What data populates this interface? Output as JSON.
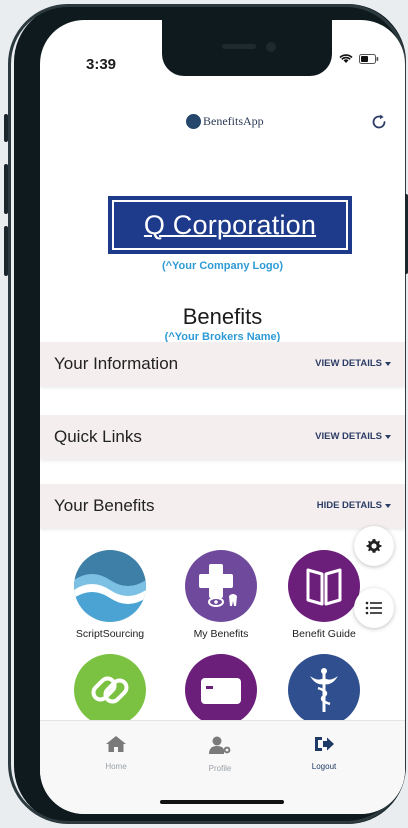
{
  "status": {
    "time": "3:39"
  },
  "appbar": {
    "brand": "BenefitsApp",
    "refresh_icon": "refresh-icon"
  },
  "company": {
    "name": "Q Corporation",
    "note": "(^Your Company Logo)"
  },
  "benefits": {
    "title": "Benefits",
    "broker_note": "(^Your Brokers Name)"
  },
  "sections": [
    {
      "title": "Your Information",
      "action": "VIEW DETAILS"
    },
    {
      "title": "Quick Links",
      "action": "VIEW DETAILS"
    },
    {
      "title": "Your Benefits",
      "action": "HIDE DETAILS"
    }
  ],
  "tiles": [
    {
      "label": "ScriptSourcing",
      "icon": "waves-icon",
      "color": "#4a9fc7"
    },
    {
      "label": "My Benefits",
      "icon": "medical-cross-icon",
      "color": "#6f4a9c"
    },
    {
      "label": "Benefit Guide",
      "icon": "book-icon",
      "color": "#6b1f7a"
    },
    {
      "label": "",
      "icon": "link-icon",
      "color": "#7cc242"
    },
    {
      "label": "",
      "icon": "id-card-icon",
      "color": "#6b1f7a"
    },
    {
      "label": "",
      "icon": "caduceus-icon",
      "color": "#2f4f8f"
    }
  ],
  "fabs": {
    "settings_icon": "gear-icon",
    "menu_icon": "list-icon"
  },
  "tabbar": {
    "items": [
      {
        "label": "Home",
        "icon": "home-icon"
      },
      {
        "label": "Profile",
        "icon": "profile-icon"
      },
      {
        "label": "Logout",
        "icon": "logout-icon"
      }
    ]
  },
  "colors": {
    "company_blue": "#1d3b8a",
    "note_blue": "#2e9ad6",
    "section_bg": "#f4eeee",
    "action_navy": "#2d3d66"
  }
}
